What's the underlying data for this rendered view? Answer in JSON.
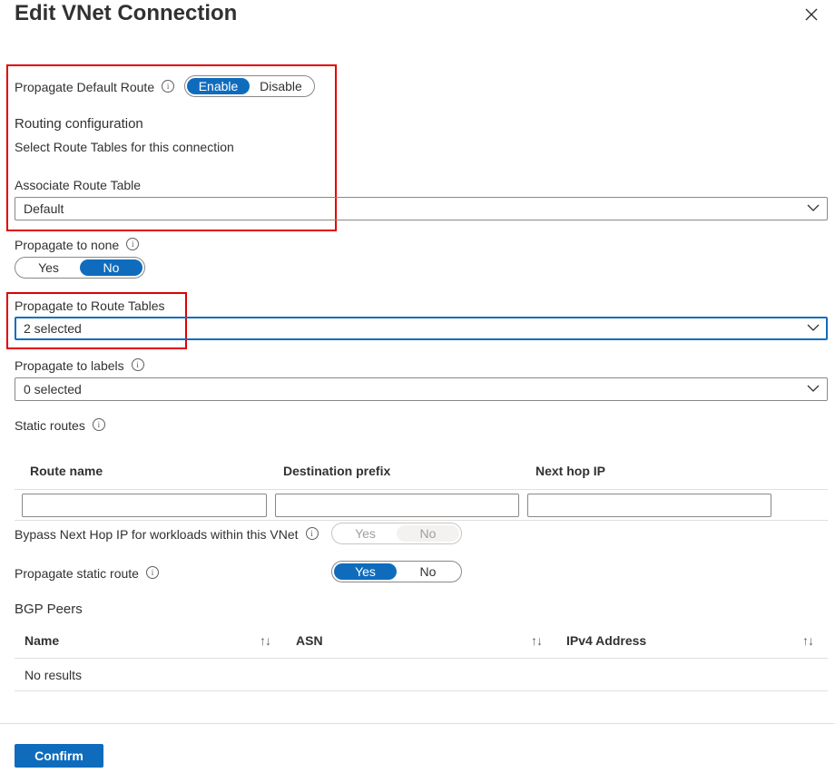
{
  "header": {
    "title": "Edit VNet Connection",
    "close_icon": "close-icon"
  },
  "propagate_default_route": {
    "label": "Propagate Default Route",
    "options": [
      "Enable",
      "Disable"
    ],
    "selected": "Enable"
  },
  "routing": {
    "heading": "Routing configuration",
    "description": "Select Route Tables for this connection",
    "associate_label": "Associate Route Table",
    "associate_value": "Default"
  },
  "propagate_to_none": {
    "label": "Propagate to none",
    "options": [
      "Yes",
      "No"
    ],
    "selected": "No"
  },
  "propagate_route_tables": {
    "label": "Propagate to Route Tables",
    "value": "2 selected"
  },
  "propagate_labels": {
    "label": "Propagate to labels",
    "value": "0 selected"
  },
  "static_routes": {
    "label": "Static routes",
    "columns": [
      "Route name",
      "Destination prefix",
      "Next hop IP"
    ]
  },
  "bypass": {
    "label": "Bypass Next Hop IP for workloads within this VNet",
    "options": [
      "Yes",
      "No"
    ],
    "selected": "No",
    "disabled": true
  },
  "propagate_static": {
    "label": "Propagate static route",
    "options": [
      "Yes",
      "No"
    ],
    "selected": "Yes"
  },
  "bgp": {
    "heading": "BGP Peers",
    "columns": [
      "Name",
      "ASN",
      "IPv4 Address"
    ],
    "empty": "No results"
  },
  "footer": {
    "confirm_label": "Confirm"
  },
  "colors": {
    "accent": "#0f6cbd",
    "highlight_box": "#e00000",
    "text": "#323130"
  }
}
